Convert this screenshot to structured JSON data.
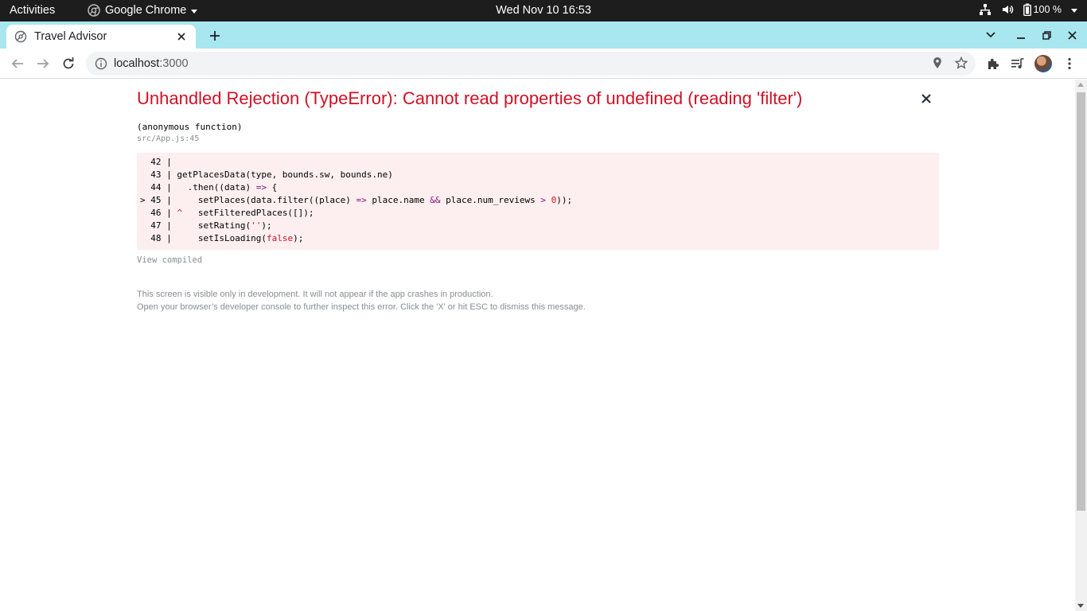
{
  "topbar": {
    "activities": "Activities",
    "app_name": "Google Chrome",
    "clock": "Wed Nov 10  16:53",
    "battery": "100 %"
  },
  "browser": {
    "tab_title": "Travel Advisor",
    "url_host": "localhost",
    "url_port": ":3000"
  },
  "error": {
    "title": "Unhandled Rejection (TypeError): Cannot read properties of undefined (reading 'filter')",
    "function_name": "(anonymous function)",
    "location": "src/App.js:45",
    "code_lines": [
      {
        "gutter": "  42 | ",
        "code": ""
      },
      {
        "gutter": "  43 | ",
        "code": "getPlacesData(type, bounds.sw, bounds.ne)"
      },
      {
        "gutter": "  44 | ",
        "code": "  .then((data) => {"
      },
      {
        "gutter": "> 45 | ",
        "code": "    setPlaces(data.filter((place) => place.name && place.num_reviews > 0));"
      },
      {
        "gutter": "  46 | ",
        "code": "^   setFilteredPlaces([]);"
      },
      {
        "gutter": "  47 | ",
        "code": "    setRating('');"
      },
      {
        "gutter": "  48 | ",
        "code": "    setIsLoading(false);"
      }
    ],
    "view_compiled": "View compiled",
    "footer_line1": "This screen is visible only in development. It will not appear if the app crashes in production.",
    "footer_line2": "Open your browser’s developer console to further inspect this error.  Click the 'X' or hit ESC to dismiss this message."
  },
  "colors": {
    "error_red": "#ce1126",
    "code_bg": "#fdeff0",
    "tabstrip": "#a8e6f0",
    "muted": "#878e91"
  },
  "icons": [
    "chrome-icon",
    "network-icon",
    "volume-icon",
    "battery-icon",
    "power-menu-icon",
    "tab-favicon-icon",
    "close-icon",
    "plus-icon",
    "chevron-down-icon",
    "minimize-icon",
    "restore-icon",
    "back-arrow-icon",
    "forward-arrow-icon",
    "reload-icon",
    "info-icon",
    "location-icon",
    "star-icon",
    "extensions-icon",
    "media-queue-icon",
    "more-vert-icon"
  ]
}
